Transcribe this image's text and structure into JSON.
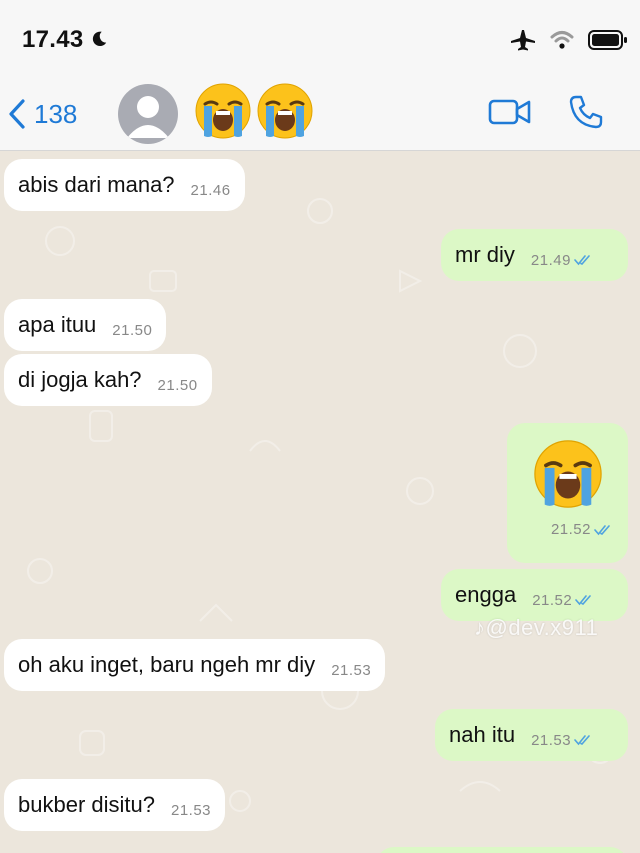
{
  "status_bar": {
    "time": "17.43",
    "icons": [
      "moon-icon",
      "airplane-icon",
      "wifi-icon",
      "battery-icon"
    ]
  },
  "header": {
    "back_count": "138",
    "contact_name_emoji": [
      "loudly-crying-face",
      "loudly-crying-face"
    ],
    "actions": [
      "video-call-icon",
      "phone-call-icon"
    ]
  },
  "messages": [
    {
      "dir": "in",
      "text": "abis dari mana?",
      "time": "21.46"
    },
    {
      "dir": "out",
      "text": "mr diy",
      "time": "21.49",
      "read": true
    },
    {
      "dir": "in",
      "text": "apa ituu",
      "time": "21.50"
    },
    {
      "dir": "in",
      "text": "di jogja kah?",
      "time": "21.50"
    },
    {
      "dir": "out",
      "text": "",
      "emoji": "loudly-crying-face",
      "time": "21.52",
      "read": true
    },
    {
      "dir": "out",
      "text": "engga",
      "time": "21.52",
      "read": true
    },
    {
      "dir": "in",
      "text": "oh aku inget, baru ngeh mr diy",
      "time": "21.53"
    },
    {
      "dir": "out",
      "text": "nah itu",
      "time": "21.53",
      "read": true
    },
    {
      "dir": "in",
      "text": "bukber disitu?",
      "time": "21.53"
    }
  ],
  "watermark": "@dev.x911",
  "colors": {
    "incoming_bubble": "#ffffff",
    "outgoing_bubble": "#dcf8c6",
    "accent": "#1f7ad6",
    "read_ticks": "#4fa3e0",
    "chat_background": "#ece6dc"
  }
}
